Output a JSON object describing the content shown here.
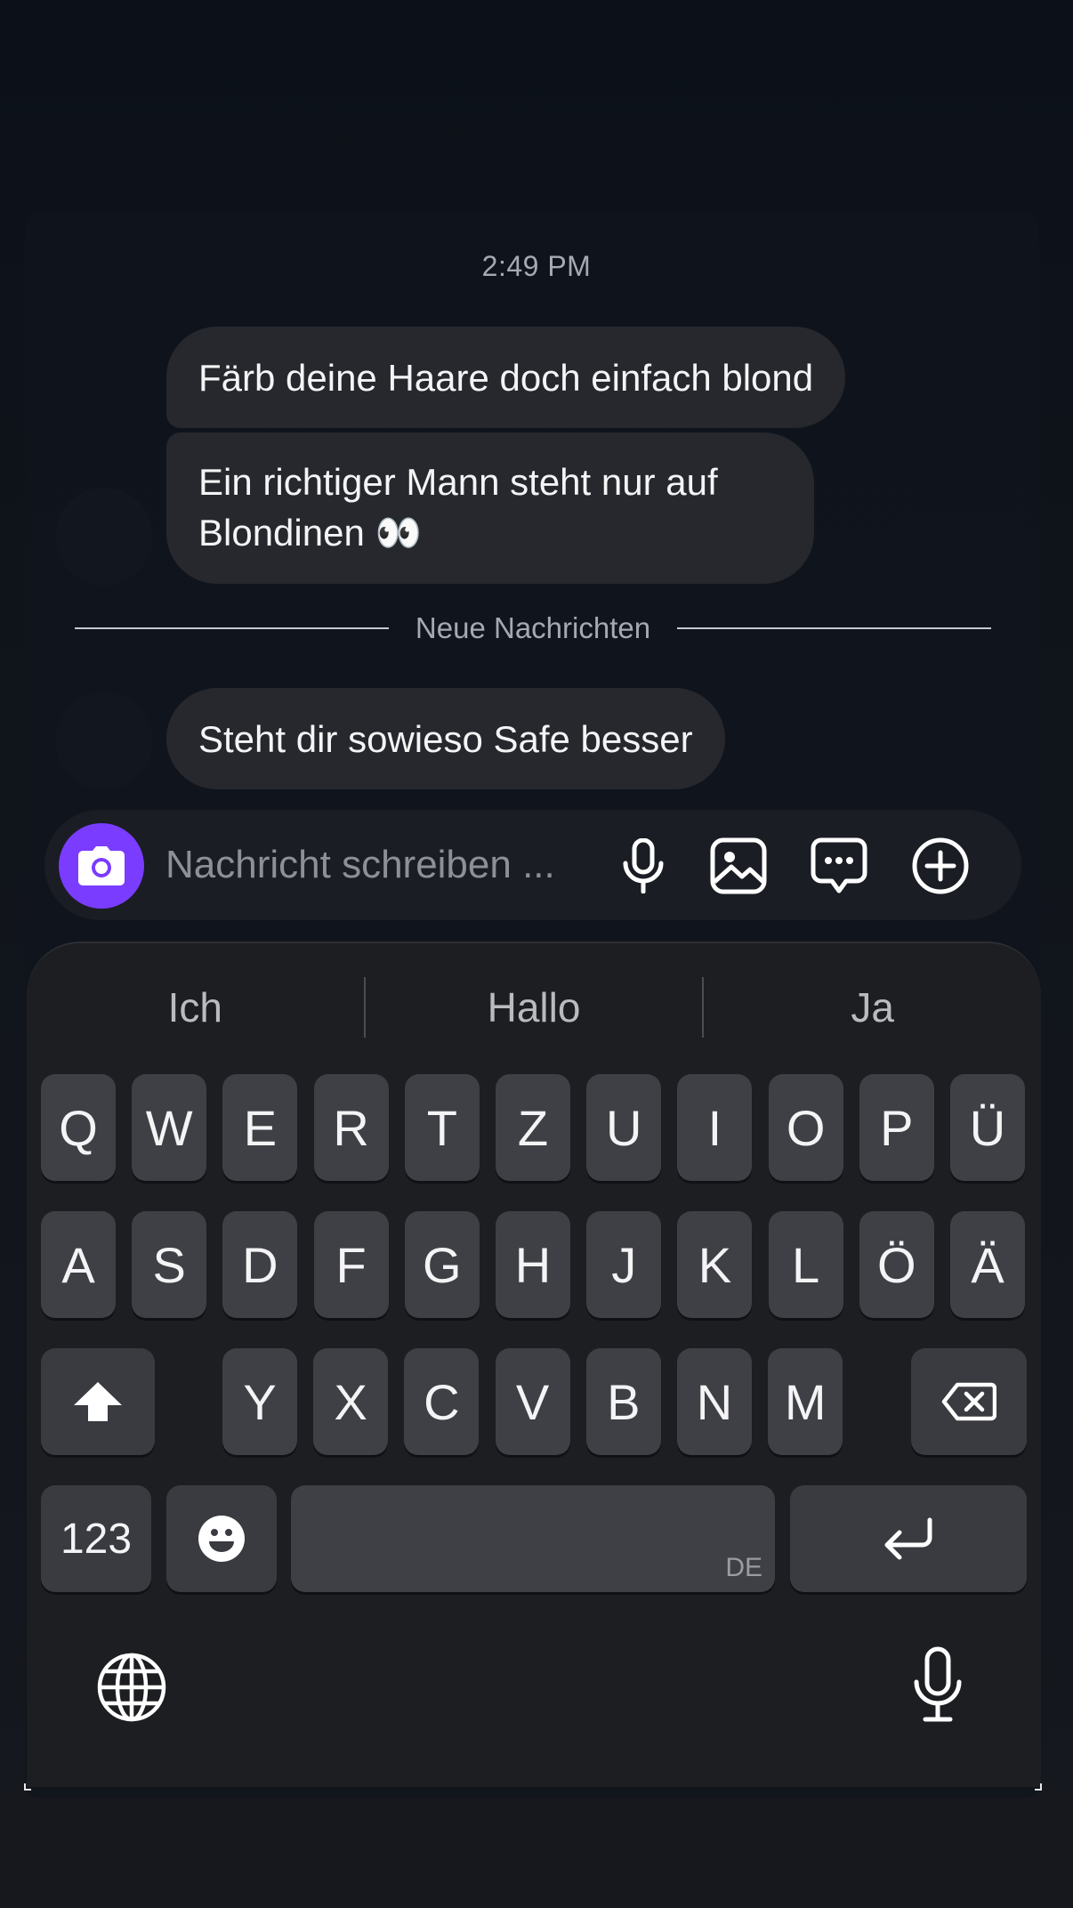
{
  "chat": {
    "timestamp": "2:49 PM",
    "messages": [
      {
        "text": "Färb deine Haare doch einfach blond"
      },
      {
        "text": "Ein richtiger Mann steht nur auf Blondinen 👀"
      },
      {
        "text": "Steht dir sowieso Safe besser"
      }
    ],
    "divider_label": "Neue Nachrichten"
  },
  "composer": {
    "placeholder": "Nachricht schreiben ...",
    "value": "",
    "icons": [
      "camera-icon",
      "microphone-icon",
      "image-icon",
      "sticker-chat-icon",
      "plus-icon"
    ],
    "accent": "#7a3cff"
  },
  "keyboard": {
    "suggestions": [
      "Ich",
      "Hallo",
      "Ja"
    ],
    "row1": [
      "Q",
      "W",
      "E",
      "R",
      "T",
      "Z",
      "U",
      "I",
      "O",
      "P",
      "Ü"
    ],
    "row2": [
      "A",
      "S",
      "D",
      "F",
      "G",
      "H",
      "J",
      "K",
      "L",
      "Ö",
      "Ä"
    ],
    "row3": [
      "Y",
      "X",
      "C",
      "V",
      "B",
      "N",
      "M"
    ],
    "numbers_label": "123",
    "space_lang": "DE",
    "icons": [
      "shift-icon",
      "backspace-icon",
      "emoji-icon",
      "return-icon",
      "globe-icon",
      "dictation-icon"
    ]
  }
}
